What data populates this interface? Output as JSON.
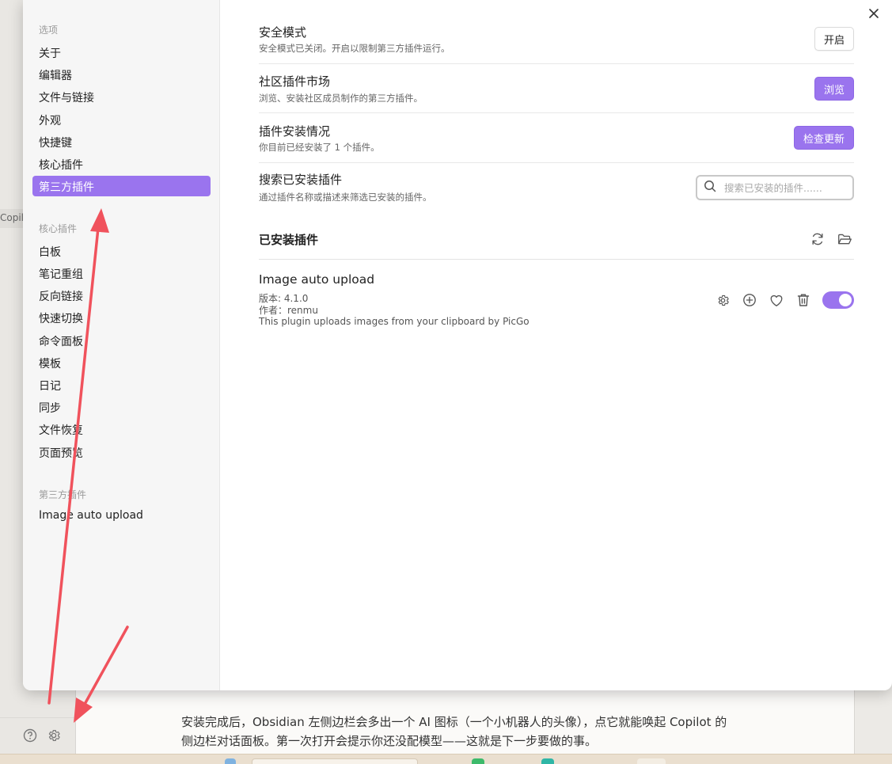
{
  "background": {
    "copilot_tab": "Copilo",
    "doc_text": "安装完成后，Obsidian 左侧边栏会多出一个 AI 图标（一个小机器人的头像），点它就能唤起 Copilot 的侧边栏对话面板。第一次打开会提示你还没配模型——这就是下一步要做的事。",
    "bottom_icons": [
      "help-icon",
      "gear-icon"
    ]
  },
  "sidebar": {
    "options_title": "选项",
    "options": [
      "关于",
      "编辑器",
      "文件与链接",
      "外观",
      "快捷键",
      "核心插件",
      "第三方插件"
    ],
    "active_option": "第三方插件",
    "core_title": "核心插件",
    "core_plugins": [
      "白板",
      "笔记重组",
      "反向链接",
      "快速切换",
      "命令面板",
      "模板",
      "日记",
      "同步",
      "文件恢复",
      "页面预览"
    ],
    "thirdparty_title": "第三方插件",
    "thirdparty_plugins": [
      "Image auto upload"
    ]
  },
  "settings": {
    "safe_mode": {
      "name": "安全模式",
      "desc": "安全模式已关闭。开启以限制第三方插件运行。",
      "button": "开启"
    },
    "community": {
      "name": "社区插件市场",
      "desc": "浏览、安装社区成员制作的第三方插件。",
      "button": "浏览"
    },
    "installed_status": {
      "name": "插件安装情况",
      "desc": "你目前已经安装了 1 个插件。",
      "button": "检查更新"
    },
    "search": {
      "name": "搜索已安装插件",
      "desc": "通过插件名称或描述来筛选已安装的插件。",
      "placeholder": "搜索已安装的插件......"
    }
  },
  "installed": {
    "title": "已安装插件",
    "icons": [
      "refresh-icon",
      "folder-open-icon"
    ],
    "plugins": [
      {
        "name": "Image auto upload",
        "version": "版本: 4.1.0",
        "author": "作者：renmu",
        "description": "This plugin uploads images from your clipboard by PicGo",
        "enabled": true
      }
    ]
  },
  "colors": {
    "accent": "#9a74ee",
    "arrow": "#f0525c"
  }
}
